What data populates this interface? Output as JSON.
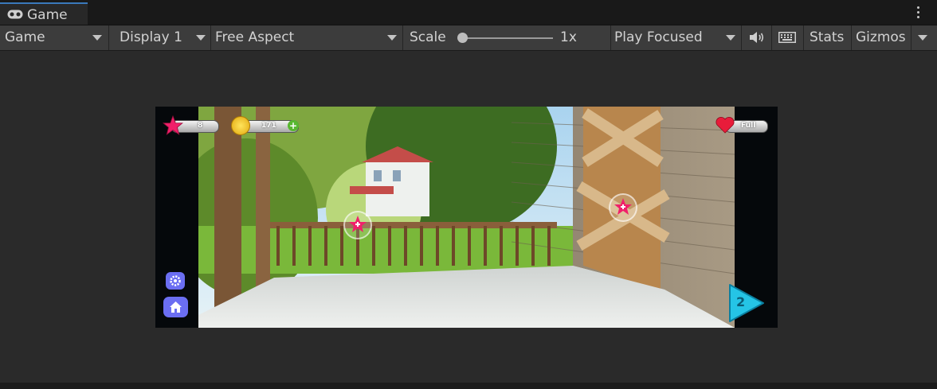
{
  "tab": {
    "label": "Game",
    "icon": "gamepad-icon"
  },
  "toolbar": {
    "mode_dropdown": "Game",
    "display_dropdown": "Display 1",
    "aspect_dropdown": "Free Aspect",
    "scale_label": "Scale",
    "scale_value": "1x",
    "scale_fraction": 0.0,
    "play_mode_dropdown": "Play Focused",
    "audio_icon": "speaker-icon",
    "keyboard_icon": "keyboard-icon",
    "stats_label": "Stats",
    "gizmos_label": "Gizmos"
  },
  "game": {
    "stars_count": "8",
    "coins_count": "171",
    "lives_label": "Full",
    "level_number": "2",
    "settings_icon": "gear-icon",
    "home_icon": "home-icon"
  },
  "colors": {
    "accent": "#3a79bb",
    "toolbar_bg": "#3c3c3c",
    "star_pink": "#f0206a",
    "coin_gold": "#f5c518",
    "play_cyan": "#25c4e6"
  }
}
